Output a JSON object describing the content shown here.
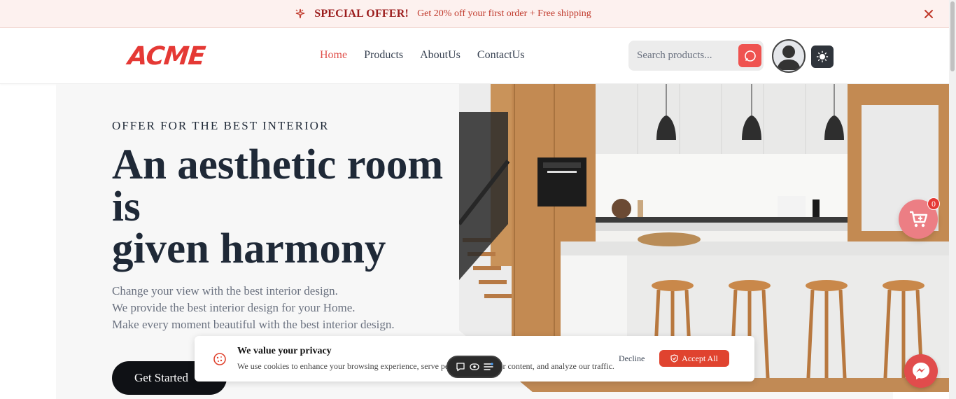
{
  "promo": {
    "title": "SPECIAL OFFER!",
    "text": "Get 20% off your first order + Free shipping",
    "icon": "sparkle-icon",
    "close_icon": "close-icon"
  },
  "header": {
    "logo": "ACME",
    "nav": [
      {
        "label": "Home",
        "active": true
      },
      {
        "label": "Products",
        "active": false
      },
      {
        "label": "AboutUs",
        "active": false
      },
      {
        "label": "ContactUs",
        "active": false
      }
    ],
    "search": {
      "placeholder": "Search products...",
      "icon": "search-icon"
    },
    "avatar_icon": "user-avatar-icon",
    "theme_icon": "sun-icon"
  },
  "hero": {
    "eyebrow": "OFFER FOR THE BEST INTERIOR",
    "title_line1": "An aesthetic room is",
    "title_line2": "given harmony",
    "sub_lines": [
      "Change your view with the best interior design.",
      "We provide the best interior design for your Home.",
      "Make every moment beautiful with the best interior design."
    ],
    "cta": "Get Started"
  },
  "cart": {
    "count": "0",
    "icon": "cart-icon"
  },
  "cookie": {
    "title": "We value your privacy",
    "text": "We use cookies to enhance your browsing experience, serve personalized ads or content, and analyze our traffic.",
    "decline": "Decline",
    "accept": "Accept All",
    "icon": "cookie-icon"
  },
  "colors": {
    "accent": "#e53935",
    "nav_active": "#e0524d",
    "dark": "#0f1115",
    "cart_bg": "#ec7e84"
  }
}
